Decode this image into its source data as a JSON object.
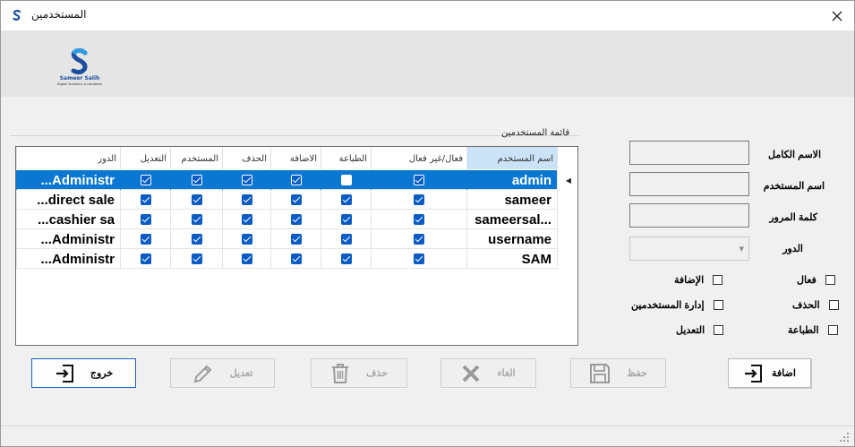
{
  "window": {
    "title": "المستخدمين"
  },
  "logo": {
    "name": "Sameer Salih",
    "tagline": "Digital Solutions & Hardware"
  },
  "group": {
    "label": "قائمة المستخدمين"
  },
  "grid": {
    "columns": [
      "اسم المستخدم",
      "فعال/غير فعال",
      "الطباعة",
      "الاضافة",
      "الحذف",
      "المستخدم",
      "التعديل",
      "الدور"
    ],
    "rows": [
      {
        "username": "admin",
        "active": true,
        "print": false,
        "add": true,
        "delete": true,
        "users": true,
        "edit": true,
        "role": "Administr...",
        "selected": true
      },
      {
        "username": "sameer",
        "active": true,
        "print": true,
        "add": true,
        "delete": true,
        "users": true,
        "edit": true,
        "role": "direct sale...",
        "selected": false
      },
      {
        "username": "sameersal...",
        "active": true,
        "print": true,
        "add": true,
        "delete": true,
        "users": true,
        "edit": true,
        "role": "cashier sa...",
        "selected": false
      },
      {
        "username": "username",
        "active": true,
        "print": true,
        "add": true,
        "delete": true,
        "users": true,
        "edit": true,
        "role": "Administr...",
        "selected": false
      },
      {
        "username": "SAM",
        "active": true,
        "print": true,
        "add": true,
        "delete": true,
        "users": true,
        "edit": true,
        "role": "Administr...",
        "selected": false
      }
    ]
  },
  "form": {
    "fullname_label": "الاسم الكامل",
    "username_label": "اسم المستخدم",
    "password_label": "كلمة المرور",
    "role_label": "الدور",
    "fullname_value": "",
    "username_value": "",
    "password_value": "",
    "role_value": ""
  },
  "permissions": {
    "active": "فعال",
    "delete": "الحذف",
    "print": "الطباعة",
    "add": "الإضافة",
    "manage_users": "إدارة المستخدمين",
    "edit": "التعديل"
  },
  "buttons": {
    "add": "اضافة",
    "save": "حفظ",
    "cancel": "الغاء",
    "delete": "حذف",
    "edit": "تعديل",
    "exit": "خروج"
  },
  "colors": {
    "selection": "#0a77d3",
    "checkbox": "#0a5bc4",
    "brand": "#1c4e9f"
  }
}
